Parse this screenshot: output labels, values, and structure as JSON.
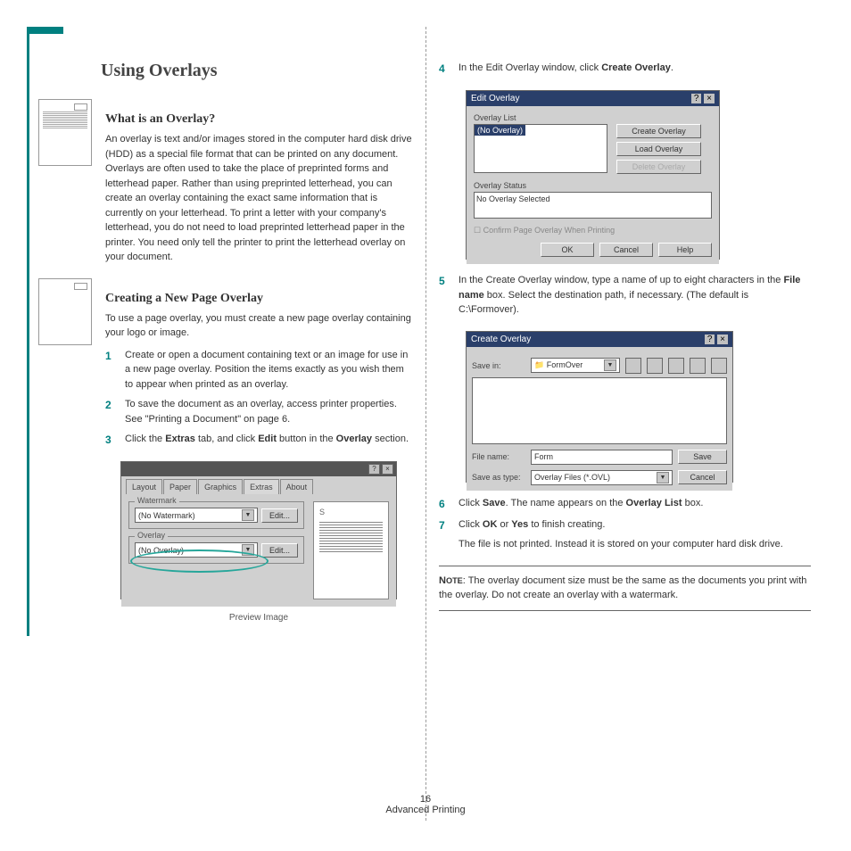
{
  "title": "Using Overlays",
  "s1": {
    "h": "What is an Overlay?",
    "p": "An overlay is text and/or images stored in the computer hard disk drive (HDD) as a special file format that can be printed on any document. Overlays are often used to take the place of preprinted forms and letterhead paper. Rather than using preprinted letterhead, you can create an overlay containing the exact same information that is currently on your letterhead. To print a letter with your company's letterhead, you do not need to load preprinted letterhead paper in the printer. You need only tell the printer to print the letterhead overlay on your document."
  },
  "s2": {
    "h": "Creating a New Page Overlay",
    "p": "To use a page overlay, you must create a new page overlay containing your logo or image.",
    "steps": [
      "Create or open a document containing text or an image for use in a new page overlay. Position the items exactly as you wish them to appear when printed as an overlay.",
      "To save the document as an overlay, access printer properties. See \"Printing a Document\" on page 6.",
      "Click the <b>Extras</b> tab, and click <b>Edit</b> button in the <b>Overlay</b> section."
    ]
  },
  "ss1": {
    "tabs": [
      "Layout",
      "Paper",
      "Graphics",
      "Extras",
      "About"
    ],
    "wm": "Watermark",
    "wmv": "(No Watermark)",
    "ov": "Overlay",
    "ovv": "(No Overlay)",
    "edit": "Edit...",
    "caption": "Preview Image"
  },
  "r": {
    "step4": "In the Edit Overlay window, click <b>Create Overlay</b>.",
    "ss2": {
      "title": "Edit Overlay",
      "ol": "Overlay List",
      "sel": "(No Overlay)",
      "b1": "Create Overlay",
      "b2": "Load Overlay",
      "b3": "Delete Overlay",
      "os": "Overlay Status",
      "osv": "No Overlay Selected",
      "chk": "Confirm Page Overlay When Printing",
      "ok": "OK",
      "cancel": "Cancel",
      "help": "Help"
    },
    "step5": "In the Create Overlay window, type a name of up to eight characters in the <b>File name</b> box. Select the destination path, if necessary. (The default is C:\\Formover).",
    "ss3": {
      "title": "Create Overlay",
      "si": "Save in:",
      "siv": "FormOver",
      "fn": "File name:",
      "fnv": "Form",
      "st": "Save as type:",
      "stv": "Overlay Files (*.OVL)",
      "save": "Save",
      "cancel": "Cancel"
    },
    "step6": "Click <b>Save</b>. The name appears on the <b>Overlay List</b> box.",
    "step7": "Click <b>OK</b> or <b>Yes</b> to finish creating.",
    "step7b": "The file is not printed. Instead it is stored on your computer hard disk drive.",
    "note": "<b>N<small>OTE</small></b>: The overlay document size must be the same as the documents you print with the overlay. Do not create an overlay with a watermark."
  },
  "footer": {
    "num": "16",
    "txt": "Advanced Printing"
  }
}
